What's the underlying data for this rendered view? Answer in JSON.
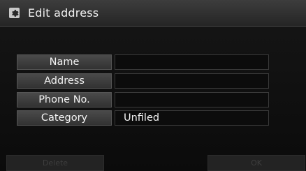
{
  "header": {
    "title": "Edit address",
    "icon": "gear-icon"
  },
  "fields": [
    {
      "label": "Name",
      "value": ""
    },
    {
      "label": "Address",
      "value": ""
    },
    {
      "label": "Phone No.",
      "value": ""
    },
    {
      "label": "Category",
      "value": "Unfiled"
    }
  ],
  "buttons": {
    "delete_label": "Delete",
    "ok_label": "OK",
    "enabled": false
  }
}
